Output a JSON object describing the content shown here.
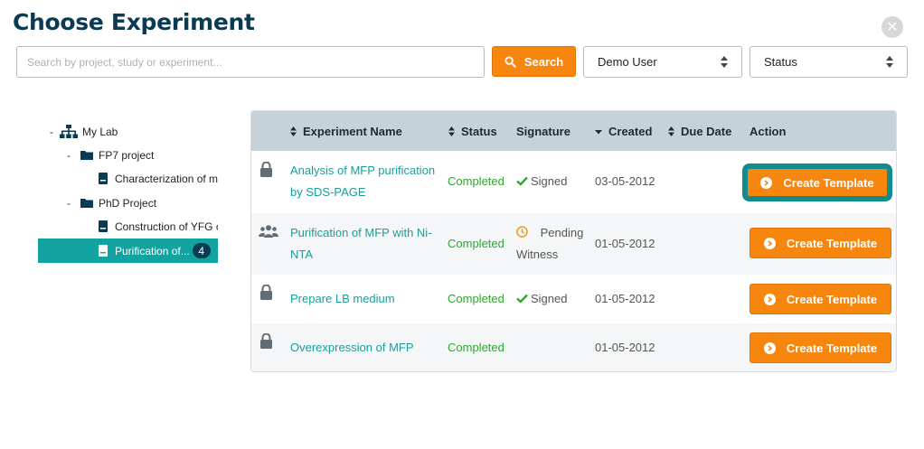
{
  "title": "Choose Experiment",
  "search": {
    "placeholder": "Search by project, study or experiment...",
    "value": "",
    "button_label": "Search"
  },
  "filters": {
    "user": "Demo User",
    "status": "Status"
  },
  "tree": {
    "root": {
      "label": "My Lab",
      "toggle": "-"
    },
    "projects": [
      {
        "label": "FP7 project",
        "toggle": "-",
        "items": [
          {
            "label": "Characterization of m"
          }
        ]
      },
      {
        "label": "PhD Project",
        "toggle": "-",
        "items": [
          {
            "label": "Construction of YFG c"
          },
          {
            "label": "Purification of...",
            "badge": "4",
            "selected": true
          }
        ]
      }
    ]
  },
  "table": {
    "columns": {
      "name": "Experiment Name",
      "status": "Status",
      "signature": "Signature",
      "created": "Created",
      "due": "Due Date",
      "action": "Action"
    },
    "rows": [
      {
        "icon": "lock-icon",
        "name": "Analysis of MFP purification by SDS-PAGE",
        "status": "Completed",
        "signature": "Signed",
        "signature_state": "signed",
        "created": "03-05-2012",
        "due": "",
        "action": "Create Template"
      },
      {
        "icon": "users-icon",
        "name": "Purification of MFP with Ni-NTA",
        "status": "Completed",
        "signature": "Pending Witness",
        "signature_state": "pending",
        "created": "01-05-2012",
        "due": "",
        "action": "Create Template"
      },
      {
        "icon": "lock-icon",
        "name": "Prepare LB medium",
        "status": "Completed",
        "signature": "Signed",
        "signature_state": "signed",
        "created": "01-05-2012",
        "due": "",
        "action": "Create Template"
      },
      {
        "icon": "lock-icon",
        "name": "Overexpression of MFP",
        "status": "Completed",
        "signature": "",
        "signature_state": "none",
        "created": "01-05-2012",
        "due": "",
        "action": "Create Template"
      }
    ]
  },
  "colors": {
    "accent": "#f7860f",
    "teal": "#12a3a1",
    "navy": "#0b3b52",
    "status_green": "#2ea72e",
    "header_bg": "#c5d2d9"
  }
}
